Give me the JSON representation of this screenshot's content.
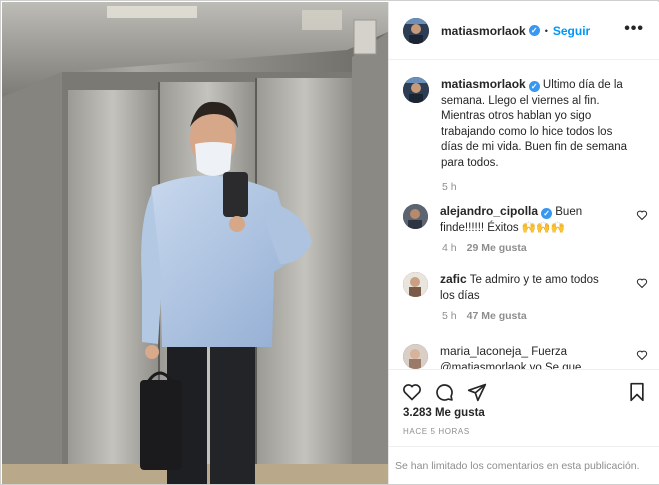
{
  "post": {
    "username": "matiasmorlaok",
    "separator": "•",
    "follow_label": "Seguir",
    "more_label": "•••",
    "caption": "Ultimo día de la semana. Llego el viernes al fin. Mientras otros hablan yo sigo trabajando como lo hice todos los días de mi vida. Buen fin de semana para todos.",
    "caption_time": "5 h",
    "likes": "3.283 Me gusta",
    "ago": "HACE 5 HORAS",
    "comments_limited": "Se han limitado los comentarios en esta publicación."
  },
  "comments": [
    {
      "username": "alejandro_cipolla",
      "verified": true,
      "text": "Buen finde!!!!!! Éxitos 🙌🙌🙌",
      "time": "4 h",
      "likes": "29 Me gusta"
    },
    {
      "username": "zafic",
      "verified": false,
      "text": "Te admiro y te amo todos los días",
      "time": "5 h",
      "likes": "47 Me gusta"
    },
    {
      "username": "maria_laconeja_",
      "verified": false,
      "text": "Fuerza @matiasmorlaok yo Se que",
      "time": "",
      "likes": ""
    }
  ],
  "icons": {
    "verified": "verified-badge-icon",
    "heart": "heart-icon",
    "comment": "comment-icon",
    "share": "share-icon",
    "save": "bookmark-icon",
    "more": "more-options-icon"
  },
  "colors": {
    "link": "#0095f6",
    "verified": "#3897f0",
    "muted": "#8e8e8e",
    "text": "#262626"
  }
}
